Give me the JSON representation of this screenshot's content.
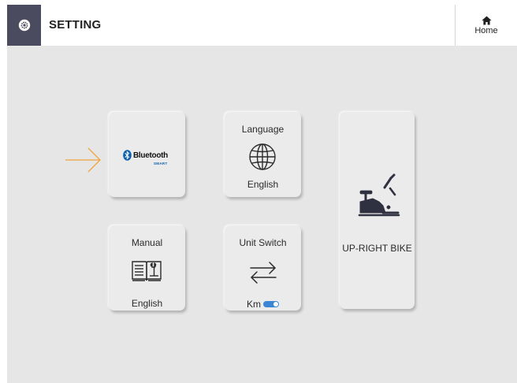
{
  "header": {
    "title": "SETTING",
    "home_label": "Home"
  },
  "tiles": {
    "bluetooth": {
      "brand": "Bluetooth",
      "brand_sub": "SMART"
    },
    "language": {
      "title": "Language",
      "value": "English"
    },
    "manual": {
      "title": "Manual",
      "value": "English"
    },
    "unit_switch": {
      "title": "Unit Switch",
      "value": "Km",
      "toggle_on": true
    },
    "machine": {
      "label": "UP-RIGHT BIKE"
    }
  },
  "icons": {
    "settings": "gear-icon",
    "home": "home-icon",
    "bluetooth": "bluetooth-icon",
    "language": "globe-icon",
    "manual": "manual-book-icon",
    "unit_switch": "swap-arrows-icon",
    "machine": "upright-bike-icon",
    "pointer": "arrow-right-icon"
  },
  "colors": {
    "settings_tab": "#4a4b5e",
    "background": "#e6e6e6",
    "tile": "#ebebeb",
    "pointer_arrow": "#f0a43a",
    "toggle": "#3b86d4",
    "bluetooth_smart": "#0a5fae"
  }
}
